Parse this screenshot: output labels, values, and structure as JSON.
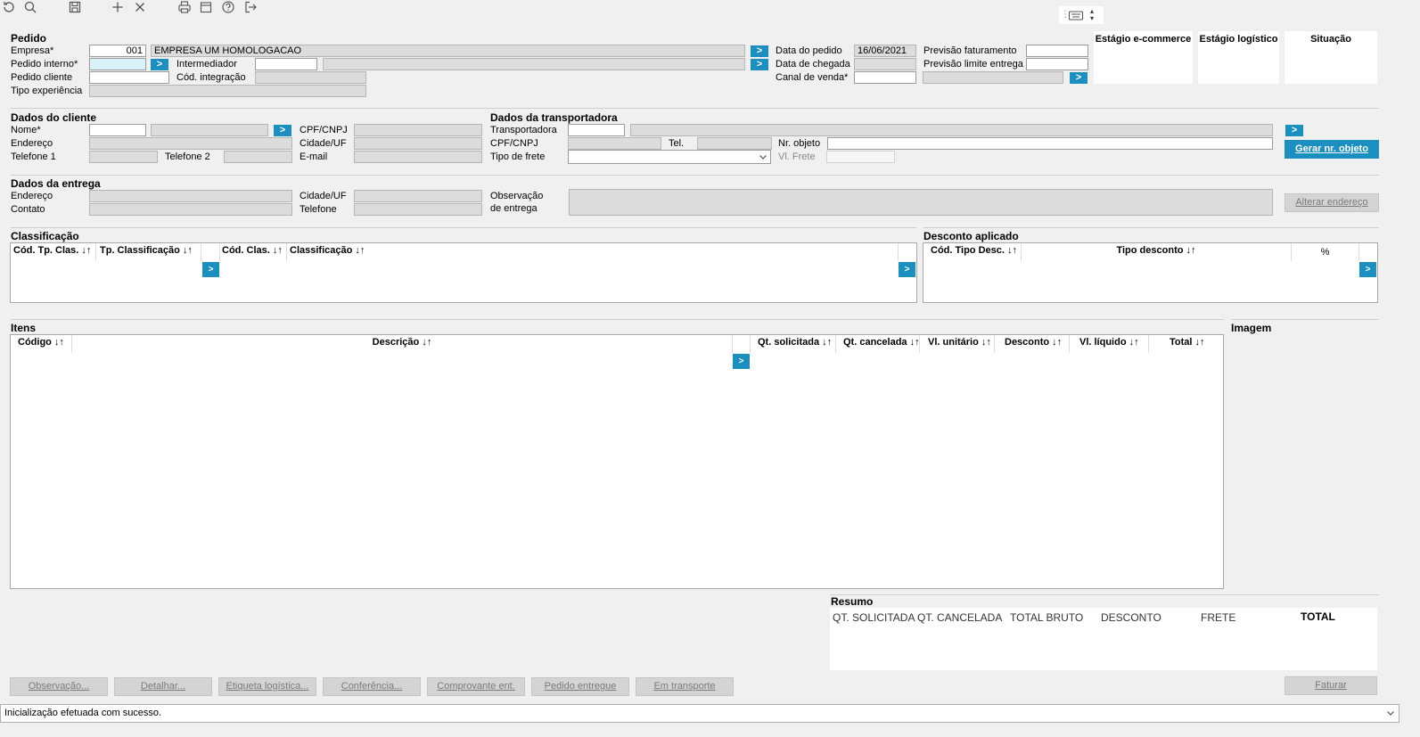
{
  "toolbar": {
    "icons": [
      "refresh-icon",
      "search-icon",
      "save-icon",
      "add-icon",
      "close-icon",
      "print-icon",
      "calendar-icon",
      "help-icon",
      "exit-icon",
      "keyboard-icon"
    ]
  },
  "pedido": {
    "title": "Pedido",
    "empresa_label": "Empresa*",
    "empresa_code": "001",
    "empresa_name": "EMPRESA UM HOMOLOGACAO",
    "pedido_interno_label": "Pedido interno*",
    "intermediador_label": "Intermediador",
    "pedido_cliente_label": "Pedido cliente",
    "cod_integracao_label": "Cód. integração",
    "tipo_experiencia_label": "Tipo experiência",
    "data_pedido_label": "Data do pedido",
    "data_pedido_value": "16/06/2021",
    "data_chegada_label": "Data de chegada",
    "canal_venda_label": "Canal de venda*",
    "previsao_faturamento_label": "Previsão faturamento",
    "previsao_limite_label": "Previsão limite entrega"
  },
  "estagio": {
    "ecommerce": "Estágio e-commerce",
    "logistico": "Estágio logístico",
    "situacao": "Situação"
  },
  "cliente": {
    "title": "Dados do cliente",
    "nome_label": "Nome*",
    "cpf_label": "CPF/CNPJ",
    "endereco_label": "Endereço",
    "cidade_label": "Cidade/UF",
    "telefone1_label": "Telefone 1",
    "telefone2_label": "Telefone 2",
    "email_label": "E-mail"
  },
  "transportadora": {
    "title": "Dados da transportadora",
    "transportadora_label": "Transportadora",
    "cpf_label": "CPF/CNPJ",
    "tel_label": "Tel.",
    "nr_objeto_label": "Nr. objeto",
    "tipo_frete_label": "Tipo de frete",
    "vl_frete_label": "Vl. Frete",
    "gerar_button": "Gerar nr. objeto"
  },
  "entrega": {
    "title": "Dados da entrega",
    "endereco_label": "Endereço",
    "contato_label": "Contato",
    "cidade_label": "Cidade/UF",
    "telefone_label": "Telefone",
    "observacao_label": "Observação",
    "de_entrega_label": "de entrega",
    "alterar_button": "Alterar endereço"
  },
  "classificacao": {
    "title": "Classificação",
    "col_cod_tp": "Cód. Tp. Clas. ↓↑",
    "col_tp": "Tp. Classificação ↓↑",
    "col_cod": "Cód. Clas. ↓↑",
    "col_clas": "Classificação ↓↑"
  },
  "desconto": {
    "title": "Desconto aplicado",
    "col_cod": "Cód. Tipo Desc. ↓↑",
    "col_tipo": "Tipo desconto ↓↑",
    "col_pct": "%"
  },
  "itens": {
    "title": "Itens",
    "imagem_label": "Imagem",
    "columns": [
      "Código ↓↑",
      "Descrição ↓↑",
      "Qt. solicitada ↓↑",
      "Qt. cancelada ↓↑",
      "Vl. unitário ↓↑",
      "Desconto ↓↑",
      "Vl. líquido ↓↑",
      "Total ↓↑"
    ]
  },
  "resumo": {
    "title": "Resumo",
    "headers": [
      "QT. SOLICITADA",
      "QT. CANCELADA",
      "TOTAL BRUTO",
      "DESCONTO",
      "FRETE",
      "TOTAL"
    ]
  },
  "buttons": {
    "observacao": "Observação...",
    "detalhar": "Detalhar...",
    "etiqueta": "Etiqueta logística...",
    "conferencia": "Conferência...",
    "comprovante": "Comprovante ent.",
    "pedido_entregue": "Pedido entregue",
    "em_transporte": "Em transporte",
    "faturar": "Faturar"
  },
  "status": {
    "message": "Inicialização efetuada com sucesso."
  },
  "colors": {
    "accent": "#1a8fc0",
    "field_readonly": "#dcdcdc",
    "field_required": "#d9f2fb"
  }
}
